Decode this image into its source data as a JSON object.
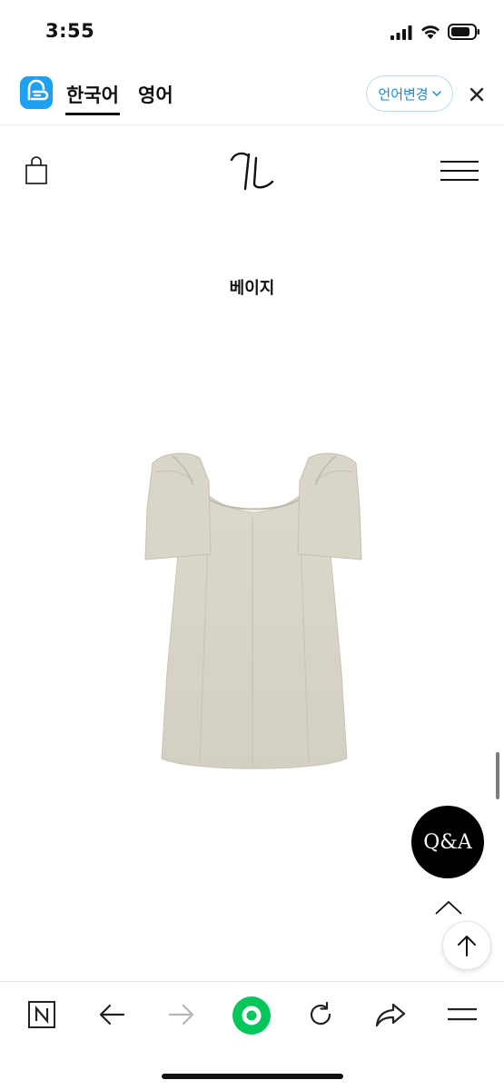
{
  "status_bar": {
    "time": "3:55"
  },
  "translate_bar": {
    "languages": [
      {
        "label": "한국어",
        "active": true
      },
      {
        "label": "영어",
        "active": false
      }
    ],
    "change_language_label": "언어변경",
    "accent_color": "#1ea1f2"
  },
  "site": {
    "header": {
      "icons": [
        "shopping-bag-icon",
        "brand-logo",
        "hamburger-menu-icon"
      ]
    },
    "color_label": "베이지"
  },
  "product": {
    "image_color": "#d8d4c7"
  },
  "floating": {
    "qa_label": "Q&A"
  },
  "bottom_bar": {
    "icons": [
      "naver-n-icon",
      "back-arrow-icon",
      "forward-arrow-icon",
      "green-home-icon",
      "reload-icon",
      "share-icon",
      "menu-icon"
    ],
    "home_color": "#03c75a"
  }
}
